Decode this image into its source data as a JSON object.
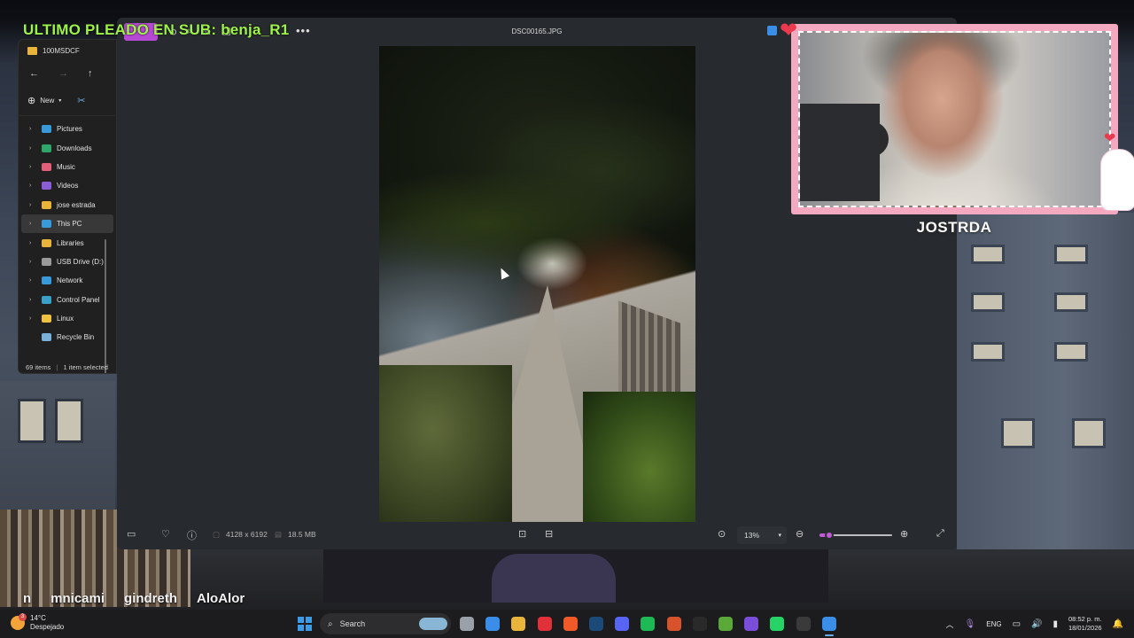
{
  "overlay": {
    "title": "ULTIMO PLEADO EN SUB: benja_R1",
    "chat_names": [
      "n",
      "mnicami",
      "gindreth",
      "AloAlor"
    ]
  },
  "explorer": {
    "folder_name": "100MSDCF",
    "new_label": "New",
    "tree_items": [
      {
        "label": "Pictures",
        "icon": "pictures-icon",
        "color": "#3a9ad9"
      },
      {
        "label": "Downloads",
        "icon": "downloads-icon",
        "color": "#2fa56a"
      },
      {
        "label": "Music",
        "icon": "music-icon",
        "color": "#e0607a"
      },
      {
        "label": "Videos",
        "icon": "videos-icon",
        "color": "#8a5cd6"
      },
      {
        "label": "jose estrada",
        "icon": "folder-icon",
        "color": "#e8b43a"
      },
      {
        "label": "This PC",
        "icon": "pc-icon",
        "color": "#3a9ad9"
      },
      {
        "label": "Libraries",
        "icon": "folder-icon",
        "color": "#e8b43a"
      },
      {
        "label": "USB Drive (D:)",
        "icon": "usb-drive-icon",
        "color": "#9a9a9a"
      },
      {
        "label": "Network",
        "icon": "network-icon",
        "color": "#3a9ad9"
      },
      {
        "label": "Control Panel",
        "icon": "control-panel-icon",
        "color": "#3aa0c8"
      },
      {
        "label": "Linux",
        "icon": "linux-icon",
        "color": "#f0c040"
      },
      {
        "label": "Recycle Bin",
        "icon": "recycle-bin-icon",
        "color": "#7ab0d8"
      }
    ],
    "status_count": "69 items",
    "status_selected": "1 item selected"
  },
  "viewer": {
    "filename": "DSC00165.JPG",
    "dimensions": "4128 x 6192",
    "file_size": "18.5 MB",
    "zoom": "13%",
    "zoom_level": 0.13,
    "accent": "#c25cd6"
  },
  "webcam": {
    "name": "JOSTRDA"
  },
  "taskbar": {
    "weather_temp": "14°C",
    "weather_desc": "Despejado",
    "weather_badge": "3",
    "search_label": "Search",
    "language": "ENG",
    "time": "08:52 p. m.",
    "date": "18/01/2026",
    "apps": [
      {
        "name": "task-view-icon",
        "color": "#9aa0a8"
      },
      {
        "name": "photos-app-icon",
        "color": "#3a8ee8"
      },
      {
        "name": "file-explorer-icon",
        "color": "#e8b43a"
      },
      {
        "name": "opera-icon",
        "color": "#e0303a"
      },
      {
        "name": "brave-icon",
        "color": "#f05a28"
      },
      {
        "name": "steam-icon",
        "color": "#1b4a78"
      },
      {
        "name": "discord-icon",
        "color": "#5865f2"
      },
      {
        "name": "spotify-icon",
        "color": "#1db954"
      },
      {
        "name": "office-icon",
        "color": "#d8532c"
      },
      {
        "name": "epic-games-icon",
        "color": "#2a2a2a"
      },
      {
        "name": "minecraft-icon",
        "color": "#5aa838"
      },
      {
        "name": "obsidian-icon",
        "color": "#7a4ed8"
      },
      {
        "name": "whatsapp-icon",
        "color": "#25d366"
      },
      {
        "name": "obs-icon",
        "color": "#3a3a3a"
      },
      {
        "name": "photos-active-icon",
        "color": "#3a8ee8"
      }
    ]
  }
}
